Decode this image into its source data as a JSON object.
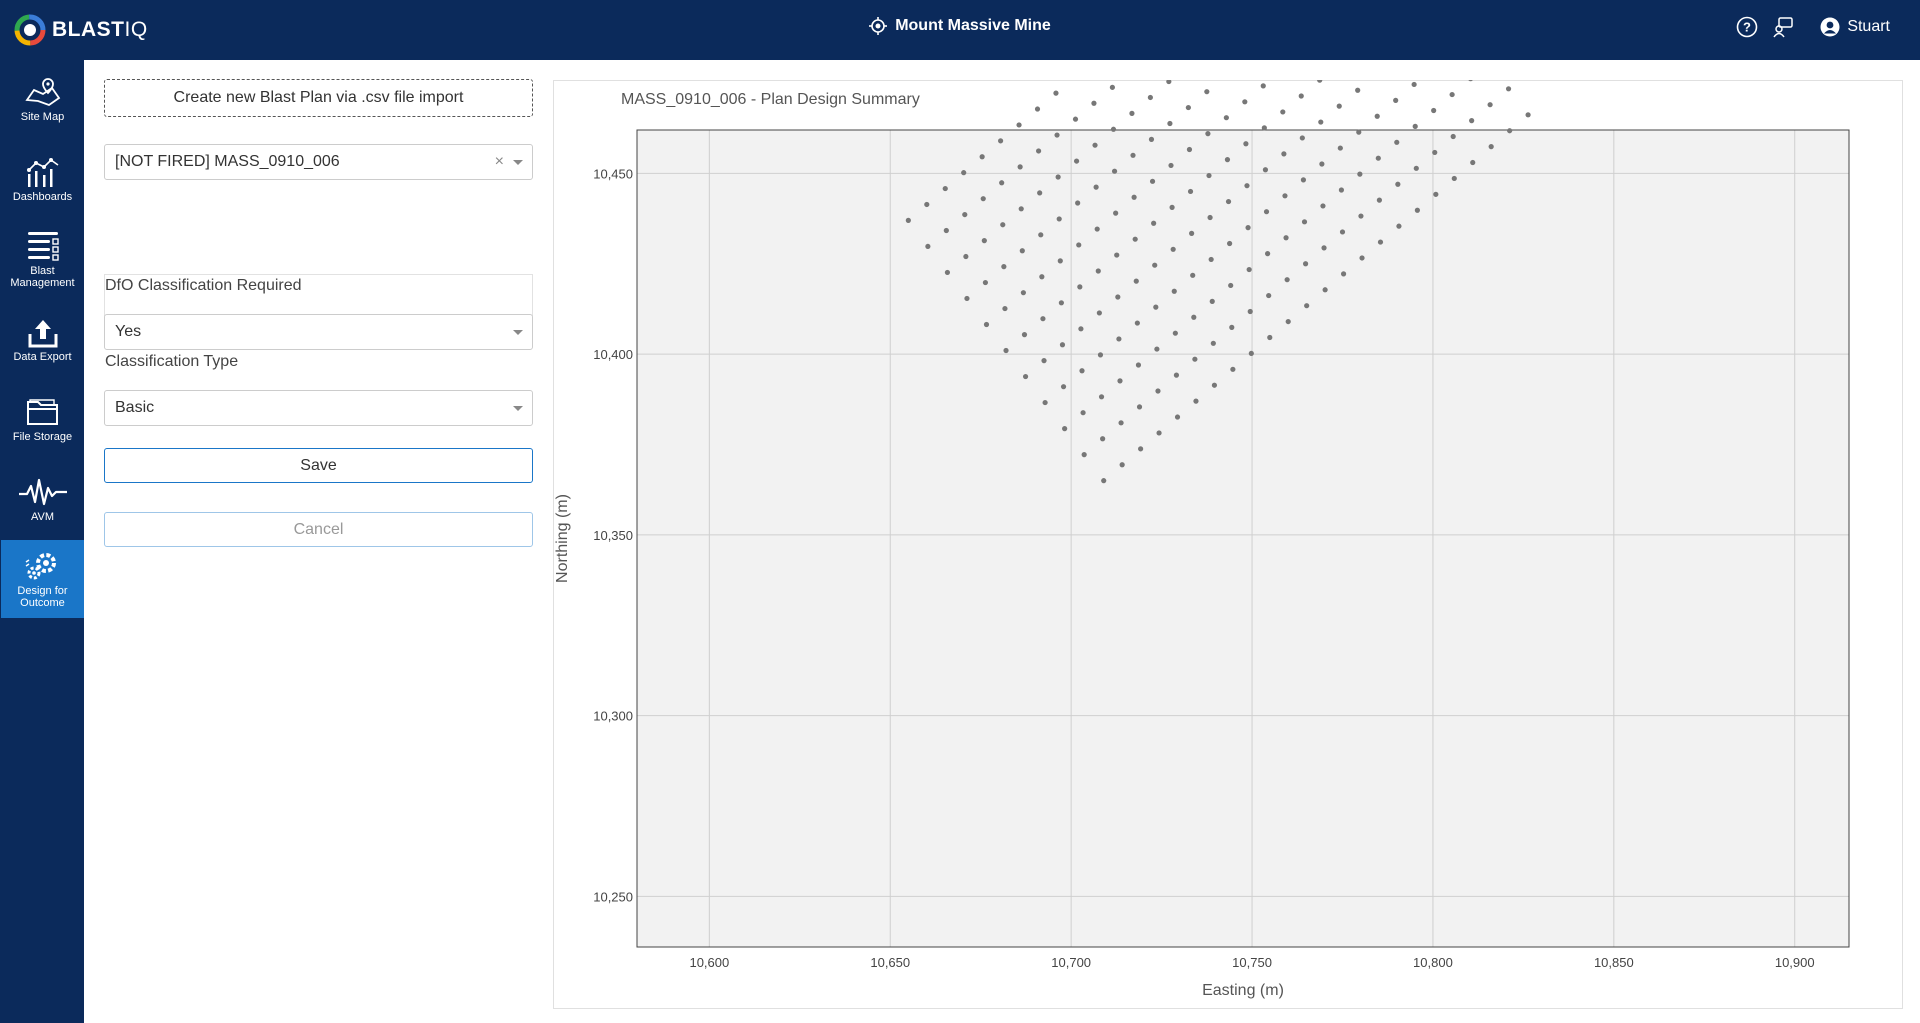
{
  "app": {
    "brand_bold": "BLAST",
    "brand_light": "IQ",
    "site_name": "Mount Massive Mine",
    "user_name": "Stuart",
    "icons": {
      "site": "target-icon",
      "help": "help-icon",
      "chat": "feedback-icon",
      "user": "user-icon"
    },
    "colors": {
      "primary": "#0b2a5b",
      "accent": "#1a76c8"
    }
  },
  "sidebar": {
    "items": [
      {
        "label": "Site Map",
        "icon": "site-map-icon"
      },
      {
        "label": "Dashboards",
        "icon": "dashboards-icon"
      },
      {
        "label": "Blast\nManagement",
        "icon": "blast-management-icon"
      },
      {
        "label": "Data Export",
        "icon": "data-export-icon"
      },
      {
        "label": "File Storage",
        "icon": "folder-icon"
      },
      {
        "label": "AVM",
        "icon": "waveform-icon"
      },
      {
        "label": "Design for\nOutcome",
        "icon": "gears-icon",
        "active": true
      }
    ]
  },
  "form": {
    "import_button": "Create new Blast Plan via .csv file import",
    "plan_select": {
      "value": "[NOT FIRED] MASS_0910_006",
      "clear": "×"
    },
    "dfo_label": "DfO Classification Required",
    "dfo_value": "Yes",
    "type_label": "Classification Type",
    "type_value": "Basic",
    "save": "Save",
    "cancel": "Cancel"
  },
  "chart": {
    "title": "MASS_0910_006 - Plan Design Summary"
  },
  "chart_data": {
    "type": "scatter",
    "title": "MASS_0910_006 - Plan Design Summary",
    "xlabel": "Easting (m)",
    "ylabel": "Northing (m)",
    "xlim": [
      10580,
      10915
    ],
    "ylim": [
      10236,
      10462
    ],
    "xticks": [
      "10,600",
      "10,650",
      "10,700",
      "10,750",
      "10,800",
      "10,850",
      "10,900"
    ],
    "yticks": [
      "10,250",
      "10,300",
      "10,350",
      "10,400",
      "10,450"
    ],
    "grid": true,
    "point_color": "#777777",
    "pattern": {
      "rows": 24,
      "cols": 11,
      "first_hole": [
        10655,
        10437
      ],
      "burden_step": [
        5.1,
        4.4
      ],
      "spacing_step": [
        5.4,
        -7.2
      ]
    }
  }
}
